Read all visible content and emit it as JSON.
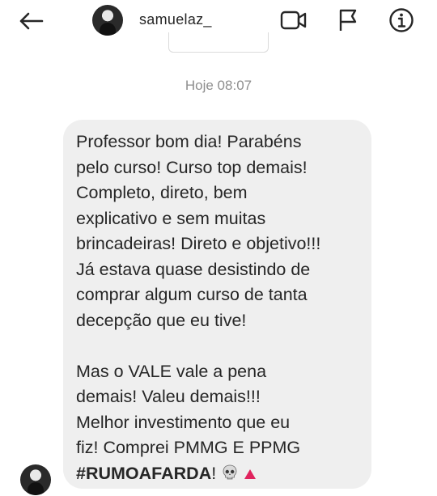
{
  "header": {
    "username": "samuelaz_",
    "icons": {
      "back": "arrow-left-icon",
      "video": "video-camera-icon",
      "report": "flag-icon",
      "info": "info-icon"
    }
  },
  "thread": {
    "timestamp": "Hoje 08:07",
    "message": {
      "paragraph_1": "Professor bom dia! Parabéns\npelo curso! Curso top demais!\nCompleto, direto, bem\nexplicativo e sem muitas\nbrincadeiras! Direto e objetivo!!!\nJá estava quase desistindo de\ncomprar algum curso de tanta\ndecepção que eu tive!",
      "paragraph_2": "Mas o VALE vale a pena\ndemais! Valeu demais!!!\nMelhor investimento que eu\nfiz! Comprei PMMG E PPMG",
      "hashtag": "#RUMOAFARDA",
      "hashtag_suffix": "!",
      "emojis": [
        "skull-icon",
        "red-triangle-icon"
      ]
    }
  },
  "colors": {
    "bubble_bg": "#efefef",
    "text": "#262626",
    "muted": "#8e8e8e",
    "triangle": "#e0245e"
  }
}
